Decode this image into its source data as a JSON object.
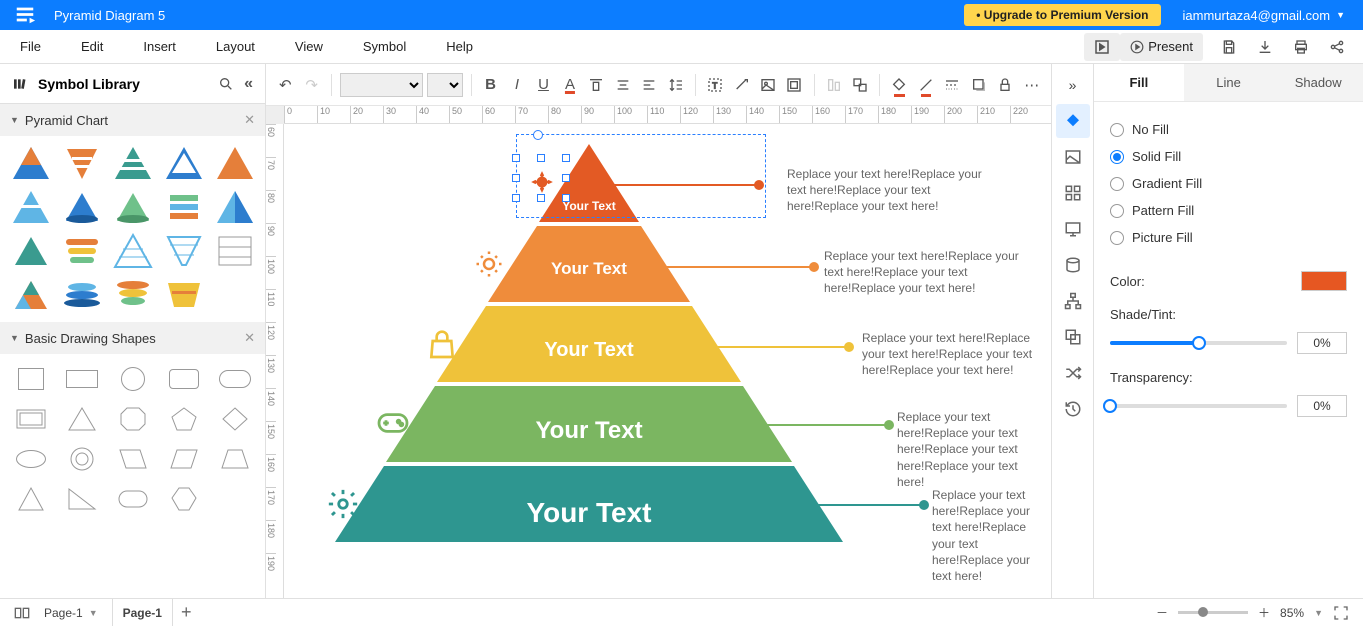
{
  "topbar": {
    "title": "Pyramid Diagram 5",
    "upgrade": "• Upgrade to Premium Version",
    "user": "iammurtaza4@gmail.com"
  },
  "menu": {
    "file": "File",
    "edit": "Edit",
    "insert": "Insert",
    "layout": "Layout",
    "view": "View",
    "symbol": "Symbol",
    "help": "Help",
    "present": "Present"
  },
  "library": {
    "title": "Symbol Library",
    "section1": "Pyramid Chart",
    "section2": "Basic Drawing Shapes"
  },
  "ruler_h": [
    "0",
    "10",
    "20",
    "30",
    "40",
    "50",
    "60",
    "70",
    "80",
    "90",
    "100",
    "110",
    "120",
    "130",
    "140",
    "150",
    "160",
    "170",
    "180",
    "190",
    "200",
    "210",
    "220"
  ],
  "ruler_v": [
    "60",
    "70",
    "80",
    "90",
    "100",
    "110",
    "120",
    "130",
    "140",
    "150",
    "160",
    "170",
    "180",
    "190"
  ],
  "pyramid": {
    "levels": [
      {
        "label": "Your Text",
        "color": "#e35a24",
        "text": "Replace your text here!Replace your text here!Replace your text here!Replace your text here!"
      },
      {
        "label": "Your Text",
        "color": "#ef8c3b",
        "text": "Replace your text here!Replace your text here!Replace your text here!Replace your text here!"
      },
      {
        "label": "Your Text",
        "color": "#efc23a",
        "text": "Replace your text here!Replace your text here!Replace your text here!Replace your text here!"
      },
      {
        "label": "Your Text",
        "color": "#7bb661",
        "text": "Replace your text here!Replace your text here!Replace your text here!Replace your text here!"
      },
      {
        "label": "Your Text",
        "color": "#2e9690",
        "text": "Replace your text here!Replace your text here!Replace your text here!Replace your text here!"
      }
    ]
  },
  "props": {
    "tabs": {
      "fill": "Fill",
      "line": "Line",
      "shadow": "Shadow"
    },
    "fill": {
      "nofill": "No Fill",
      "solid": "Solid Fill",
      "gradient": "Gradient Fill",
      "pattern": "Pattern Fill",
      "picture": "Picture Fill",
      "color_label": "Color:",
      "color": "#e65722",
      "shade_label": "Shade/Tint:",
      "shade_val": "0%",
      "trans_label": "Transparency:",
      "trans_val": "0%"
    }
  },
  "footer": {
    "page_select": "Page-1",
    "page_tab": "Page-1",
    "zoom": "85%"
  }
}
